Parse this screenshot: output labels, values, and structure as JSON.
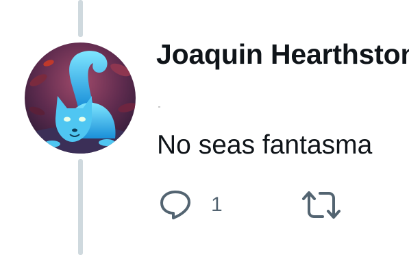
{
  "tweet": {
    "author": {
      "display_name": "Joaquin Hearthstone",
      "avatar": "blue-fox-avatar"
    },
    "text": "No seas fantasma",
    "actions": {
      "reply": {
        "icon": "reply-icon",
        "count": "1"
      },
      "retweet": {
        "icon": "retweet-icon"
      }
    }
  },
  "colors": {
    "text_primary": "#0f1419",
    "text_secondary": "#536471",
    "thread_line": "#cfd9de",
    "background": "#ffffff"
  }
}
